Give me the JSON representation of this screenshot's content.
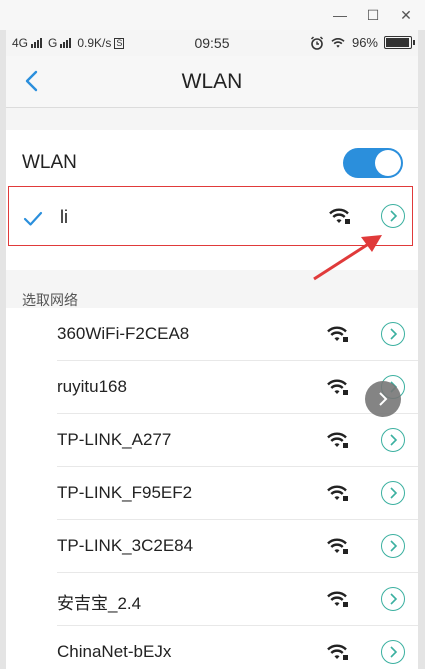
{
  "status_bar": {
    "sim1": "4G",
    "sim2": "G",
    "speed": "0.9K/s",
    "speed_badge": "S",
    "time": "09:55",
    "battery": "96%",
    "battery_level": 0.96
  },
  "header": {
    "title": "WLAN"
  },
  "wlan": {
    "label": "WLAN",
    "enabled": true
  },
  "connected": {
    "name": "li"
  },
  "section": {
    "label": "选取网络"
  },
  "networks": [
    {
      "name": "360WiFi-F2CEA8"
    },
    {
      "name": "ruyitu168"
    },
    {
      "name": "TP-LINK_A277"
    },
    {
      "name": "TP-LINK_F95EF2"
    },
    {
      "name": "TP-LINK_3C2E84"
    },
    {
      "name": "安吉宝_2.4"
    },
    {
      "name": "ChinaNet-bEJx"
    }
  ],
  "colors": {
    "accent": "#2b8fdc",
    "teal": "#3bb0a0",
    "highlight_border": "#e03a3a"
  },
  "window": {
    "minimize": "—",
    "maximize": "☐",
    "close": "✕"
  }
}
